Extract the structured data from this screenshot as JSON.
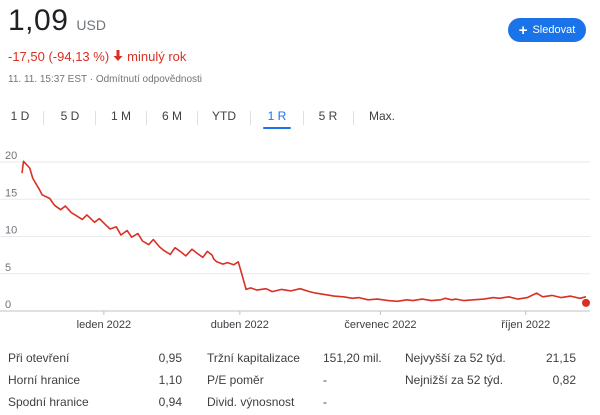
{
  "quote": {
    "price": "1,09",
    "currency": "USD",
    "change": "-17,50 (-94,13 %)",
    "change_period": "minulý rok",
    "timestamp": "11. 11. 15:37 EST",
    "disclaimer": "Odmítnutí odpovědnosti",
    "color_down": "#d93025",
    "arrow_icon": "arrow-down-icon"
  },
  "follow_button": {
    "label": "Sledovat",
    "icon": "plus-icon",
    "color": "#1a73e8"
  },
  "tabs": [
    {
      "label": "1 D",
      "active": false
    },
    {
      "label": "5 D",
      "active": false
    },
    {
      "label": "1 M",
      "active": false
    },
    {
      "label": "6 M",
      "active": false
    },
    {
      "label": "YTD",
      "active": false
    },
    {
      "label": "1 R",
      "active": true
    },
    {
      "label": "5 R",
      "active": false
    },
    {
      "label": "Max.",
      "active": false
    }
  ],
  "chart_data": {
    "type": "line",
    "x_tick_labels": [
      "leden 2022",
      "duben 2022",
      "červenec 2022",
      "říjen 2022"
    ],
    "x_tick_dates": [
      "2022-01-03",
      "2022-04-01",
      "2022-07-01",
      "2022-10-03"
    ],
    "yticks": [
      0,
      5,
      10,
      15,
      20
    ],
    "ylim": [
      0,
      20
    ],
    "xlim": [
      "2021-11-11",
      "2022-11-11"
    ],
    "grid": true,
    "line_color": "#d93025",
    "series": [
      {
        "x": [
          "2021-11-11",
          "2021-11-12",
          "2021-11-16",
          "2021-11-18",
          "2021-11-22",
          "2021-11-24",
          "2021-11-29",
          "2021-12-02",
          "2021-12-06",
          "2021-12-09",
          "2021-12-13",
          "2021-12-16",
          "2021-12-20",
          "2021-12-23",
          "2021-12-28",
          "2021-12-31",
          "2022-01-04",
          "2022-01-07",
          "2022-01-11",
          "2022-01-14",
          "2022-01-18",
          "2022-01-21",
          "2022-01-25",
          "2022-01-28",
          "2022-02-01",
          "2022-02-04",
          "2022-02-08",
          "2022-02-11",
          "2022-02-15",
          "2022-02-18",
          "2022-02-22",
          "2022-02-25",
          "2022-03-01",
          "2022-03-04",
          "2022-03-08",
          "2022-03-11",
          "2022-03-14",
          "2022-03-15",
          "2022-03-17",
          "2022-03-21",
          "2022-03-24",
          "2022-03-28",
          "2022-03-31",
          "2022-04-05",
          "2022-04-08",
          "2022-04-12",
          "2022-04-18",
          "2022-04-22",
          "2022-04-28",
          "2022-05-04",
          "2022-05-10",
          "2022-05-16",
          "2022-05-20",
          "2022-05-26",
          "2022-06-01",
          "2022-06-07",
          "2022-06-13",
          "2022-06-17",
          "2022-06-23",
          "2022-06-29",
          "2022-07-06",
          "2022-07-12",
          "2022-07-18",
          "2022-07-22",
          "2022-07-28",
          "2022-08-03",
          "2022-08-09",
          "2022-08-12",
          "2022-08-16",
          "2022-08-19",
          "2022-08-24",
          "2022-08-30",
          "2022-09-06",
          "2022-09-12",
          "2022-09-16",
          "2022-09-22",
          "2022-09-28",
          "2022-10-04",
          "2022-10-10",
          "2022-10-14",
          "2022-10-20",
          "2022-10-26",
          "2022-11-01",
          "2022-11-07",
          "2022-11-11"
        ],
        "y": [
          18.5,
          20.1,
          19.2,
          17.8,
          16.4,
          15.6,
          15.1,
          14.2,
          13.6,
          14.1,
          13.2,
          12.8,
          12.3,
          12.9,
          11.9,
          12.4,
          11.6,
          11.0,
          11.3,
          10.2,
          10.8,
          9.9,
          10.4,
          9.4,
          8.9,
          9.6,
          8.6,
          8.1,
          7.6,
          8.5,
          7.9,
          7.4,
          8.3,
          7.8,
          7.2,
          8.0,
          7.5,
          7.0,
          6.6,
          6.3,
          6.5,
          6.2,
          6.6,
          2.9,
          3.1,
          2.8,
          3.0,
          2.6,
          2.9,
          2.7,
          3.0,
          2.6,
          2.4,
          2.2,
          2.0,
          1.9,
          1.7,
          1.8,
          1.5,
          1.6,
          1.4,
          1.3,
          1.5,
          1.4,
          1.6,
          1.4,
          1.5,
          1.7,
          1.5,
          1.6,
          1.4,
          1.5,
          1.6,
          1.8,
          1.7,
          1.9,
          1.6,
          1.8,
          2.4,
          1.9,
          2.1,
          1.8,
          2.0,
          1.7,
          1.9
        ]
      }
    ],
    "end_point": {
      "x": "2022-11-11",
      "y": 1.09
    }
  },
  "stats": [
    {
      "label": "Při otevření",
      "value": "0,95"
    },
    {
      "label": "Horní hranice",
      "value": "1,10"
    },
    {
      "label": "Spodní hranice",
      "value": "0,94"
    },
    {
      "label": "Tržní kapitalizace",
      "value": "151,20 mil."
    },
    {
      "label": "P/E poměr",
      "value": "-"
    },
    {
      "label": "Divid. výnosnost",
      "value": "-"
    },
    {
      "label": "Nejvyšší za 52 týd.",
      "value": "21,15"
    },
    {
      "label": "Nejnižší za 52 týd.",
      "value": "0,82"
    }
  ]
}
